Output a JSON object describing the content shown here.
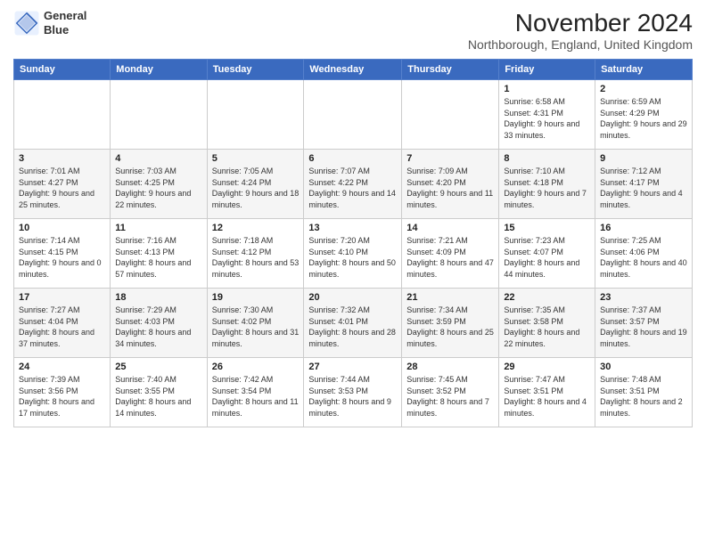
{
  "logo": {
    "line1": "General",
    "line2": "Blue"
  },
  "title": "November 2024",
  "location": "Northborough, England, United Kingdom",
  "headers": [
    "Sunday",
    "Monday",
    "Tuesday",
    "Wednesday",
    "Thursday",
    "Friday",
    "Saturday"
  ],
  "weeks": [
    [
      {
        "day": "",
        "info": ""
      },
      {
        "day": "",
        "info": ""
      },
      {
        "day": "",
        "info": ""
      },
      {
        "day": "",
        "info": ""
      },
      {
        "day": "",
        "info": ""
      },
      {
        "day": "1",
        "info": "Sunrise: 6:58 AM\nSunset: 4:31 PM\nDaylight: 9 hours and 33 minutes."
      },
      {
        "day": "2",
        "info": "Sunrise: 6:59 AM\nSunset: 4:29 PM\nDaylight: 9 hours and 29 minutes."
      }
    ],
    [
      {
        "day": "3",
        "info": "Sunrise: 7:01 AM\nSunset: 4:27 PM\nDaylight: 9 hours and 25 minutes."
      },
      {
        "day": "4",
        "info": "Sunrise: 7:03 AM\nSunset: 4:25 PM\nDaylight: 9 hours and 22 minutes."
      },
      {
        "day": "5",
        "info": "Sunrise: 7:05 AM\nSunset: 4:24 PM\nDaylight: 9 hours and 18 minutes."
      },
      {
        "day": "6",
        "info": "Sunrise: 7:07 AM\nSunset: 4:22 PM\nDaylight: 9 hours and 14 minutes."
      },
      {
        "day": "7",
        "info": "Sunrise: 7:09 AM\nSunset: 4:20 PM\nDaylight: 9 hours and 11 minutes."
      },
      {
        "day": "8",
        "info": "Sunrise: 7:10 AM\nSunset: 4:18 PM\nDaylight: 9 hours and 7 minutes."
      },
      {
        "day": "9",
        "info": "Sunrise: 7:12 AM\nSunset: 4:17 PM\nDaylight: 9 hours and 4 minutes."
      }
    ],
    [
      {
        "day": "10",
        "info": "Sunrise: 7:14 AM\nSunset: 4:15 PM\nDaylight: 9 hours and 0 minutes."
      },
      {
        "day": "11",
        "info": "Sunrise: 7:16 AM\nSunset: 4:13 PM\nDaylight: 8 hours and 57 minutes."
      },
      {
        "day": "12",
        "info": "Sunrise: 7:18 AM\nSunset: 4:12 PM\nDaylight: 8 hours and 53 minutes."
      },
      {
        "day": "13",
        "info": "Sunrise: 7:20 AM\nSunset: 4:10 PM\nDaylight: 8 hours and 50 minutes."
      },
      {
        "day": "14",
        "info": "Sunrise: 7:21 AM\nSunset: 4:09 PM\nDaylight: 8 hours and 47 minutes."
      },
      {
        "day": "15",
        "info": "Sunrise: 7:23 AM\nSunset: 4:07 PM\nDaylight: 8 hours and 44 minutes."
      },
      {
        "day": "16",
        "info": "Sunrise: 7:25 AM\nSunset: 4:06 PM\nDaylight: 8 hours and 40 minutes."
      }
    ],
    [
      {
        "day": "17",
        "info": "Sunrise: 7:27 AM\nSunset: 4:04 PM\nDaylight: 8 hours and 37 minutes."
      },
      {
        "day": "18",
        "info": "Sunrise: 7:29 AM\nSunset: 4:03 PM\nDaylight: 8 hours and 34 minutes."
      },
      {
        "day": "19",
        "info": "Sunrise: 7:30 AM\nSunset: 4:02 PM\nDaylight: 8 hours and 31 minutes."
      },
      {
        "day": "20",
        "info": "Sunrise: 7:32 AM\nSunset: 4:01 PM\nDaylight: 8 hours and 28 minutes."
      },
      {
        "day": "21",
        "info": "Sunrise: 7:34 AM\nSunset: 3:59 PM\nDaylight: 8 hours and 25 minutes."
      },
      {
        "day": "22",
        "info": "Sunrise: 7:35 AM\nSunset: 3:58 PM\nDaylight: 8 hours and 22 minutes."
      },
      {
        "day": "23",
        "info": "Sunrise: 7:37 AM\nSunset: 3:57 PM\nDaylight: 8 hours and 19 minutes."
      }
    ],
    [
      {
        "day": "24",
        "info": "Sunrise: 7:39 AM\nSunset: 3:56 PM\nDaylight: 8 hours and 17 minutes."
      },
      {
        "day": "25",
        "info": "Sunrise: 7:40 AM\nSunset: 3:55 PM\nDaylight: 8 hours and 14 minutes."
      },
      {
        "day": "26",
        "info": "Sunrise: 7:42 AM\nSunset: 3:54 PM\nDaylight: 8 hours and 11 minutes."
      },
      {
        "day": "27",
        "info": "Sunrise: 7:44 AM\nSunset: 3:53 PM\nDaylight: 8 hours and 9 minutes."
      },
      {
        "day": "28",
        "info": "Sunrise: 7:45 AM\nSunset: 3:52 PM\nDaylight: 8 hours and 7 minutes."
      },
      {
        "day": "29",
        "info": "Sunrise: 7:47 AM\nSunset: 3:51 PM\nDaylight: 8 hours and 4 minutes."
      },
      {
        "day": "30",
        "info": "Sunrise: 7:48 AM\nSunset: 3:51 PM\nDaylight: 8 hours and 2 minutes."
      }
    ]
  ]
}
